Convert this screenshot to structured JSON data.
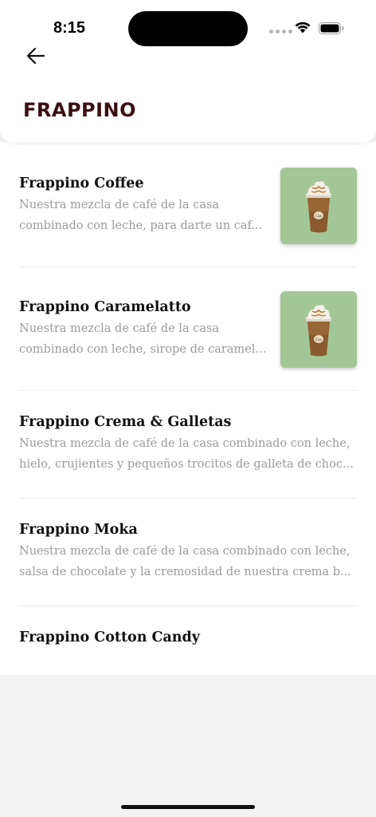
{
  "status_bar": {
    "time": "8:15"
  },
  "header": {
    "title": "FRAPPINO",
    "back_icon": "arrow-left-icon"
  },
  "items": [
    {
      "name": "Frappino Coffee",
      "desc_lines": [
        "Nuestra mezcla de café de la casa",
        "combinado con leche, para darte un caf..."
      ],
      "has_image": true
    },
    {
      "name": "Frappino Caramelatto",
      "desc_lines": [
        "Nuestra mezcla de café de la casa",
        "combinado con leche, sirope de caramel..."
      ],
      "has_image": true
    },
    {
      "name": "Frappino Crema & Galletas",
      "desc_lines": [
        "Nuestra mezcla de café de la casa combinado con leche,",
        "hielo, crujientes y pequeños trocitos de galleta de choc..."
      ],
      "has_image": false
    },
    {
      "name": "Frappino Moka",
      "desc_lines": [
        "Nuestra mezcla de café de la casa combinado con leche,",
        "salsa de chocolate y la cremosidad de nuestra crema b..."
      ],
      "has_image": false
    },
    {
      "name": "Frappino Cotton Candy",
      "desc_lines": [],
      "has_image": false
    }
  ],
  "colors": {
    "title": "#3a0f14",
    "thumb_bg": "#a3c696",
    "desc": "#9a9a9a"
  }
}
